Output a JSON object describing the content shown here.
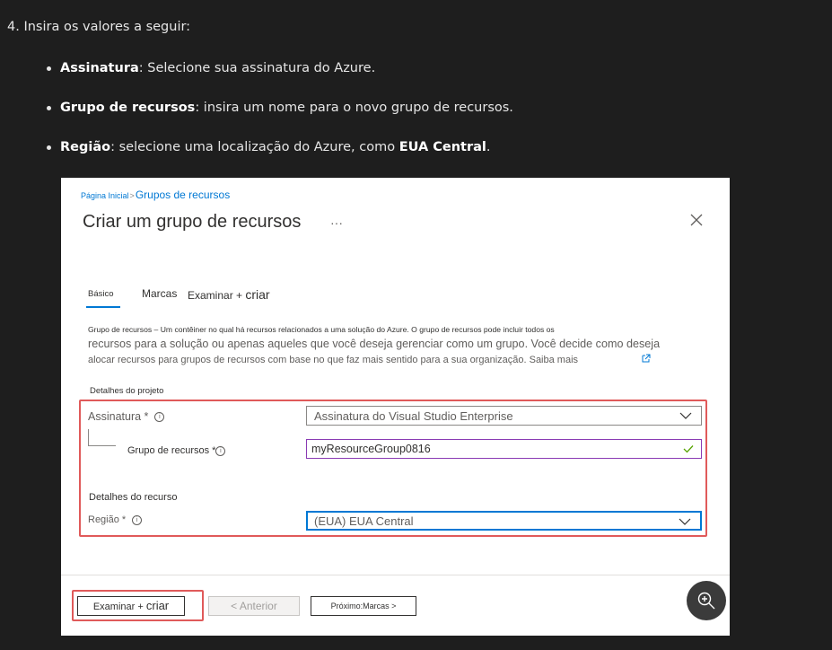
{
  "instructions": {
    "step": "4. Insira os valores a seguir:",
    "items": [
      {
        "term": "Assinatura",
        "text": ": Selecione sua assinatura do Azure."
      },
      {
        "term": "Grupo de recursos",
        "text": ": insira um nome para o novo grupo de recursos."
      },
      {
        "term": "Região",
        "text": ": selecione uma localização do Azure, como ",
        "strong": "EUA Central",
        "end": "."
      }
    ]
  },
  "portal": {
    "breadcrumb": {
      "home": "Página Inicial",
      "sep": ">",
      "current": "Grupos de recursos"
    },
    "title": "Criar um grupo de recursos",
    "ellipsis": "···",
    "tabs": {
      "basics": "Básico",
      "tags": "Marcas",
      "review_prefix": "Examinar +",
      "review_suffix": "criar"
    },
    "description": {
      "line1": "Grupo de recursos –   Um contêiner no qual há recursos relacionados a uma solução do Azure. O grupo de recursos pode incluir todos os",
      "line2": "recursos para a solução ou apenas aqueles que você deseja gerenciar como um grupo. Você decide como deseja",
      "line3": "alocar recursos para grupos de recursos com base no que faz mais sentido para a sua organização. Saiba mais"
    },
    "project_details": "Detalhes do projeto",
    "subscription": {
      "label": "Assinatura *",
      "value": "Assinatura do Visual Studio Enterprise"
    },
    "resource_group": {
      "label": "Grupo de recursos *",
      "value": "myResourceGroup0816"
    },
    "resource_details": "Detalhes do recurso",
    "region": {
      "label": "Região *",
      "value": "(EUA) EUA Central"
    },
    "footer": {
      "review_prefix": "Examinar +",
      "review_suffix": "criar",
      "previous": "< Anterior",
      "next": "Próximo:Marcas >"
    }
  },
  "colors": {
    "page_bg": "#1e1e1e",
    "accent": "#0078d4",
    "highlight": "#e05a5a",
    "valid": "#57a300"
  }
}
